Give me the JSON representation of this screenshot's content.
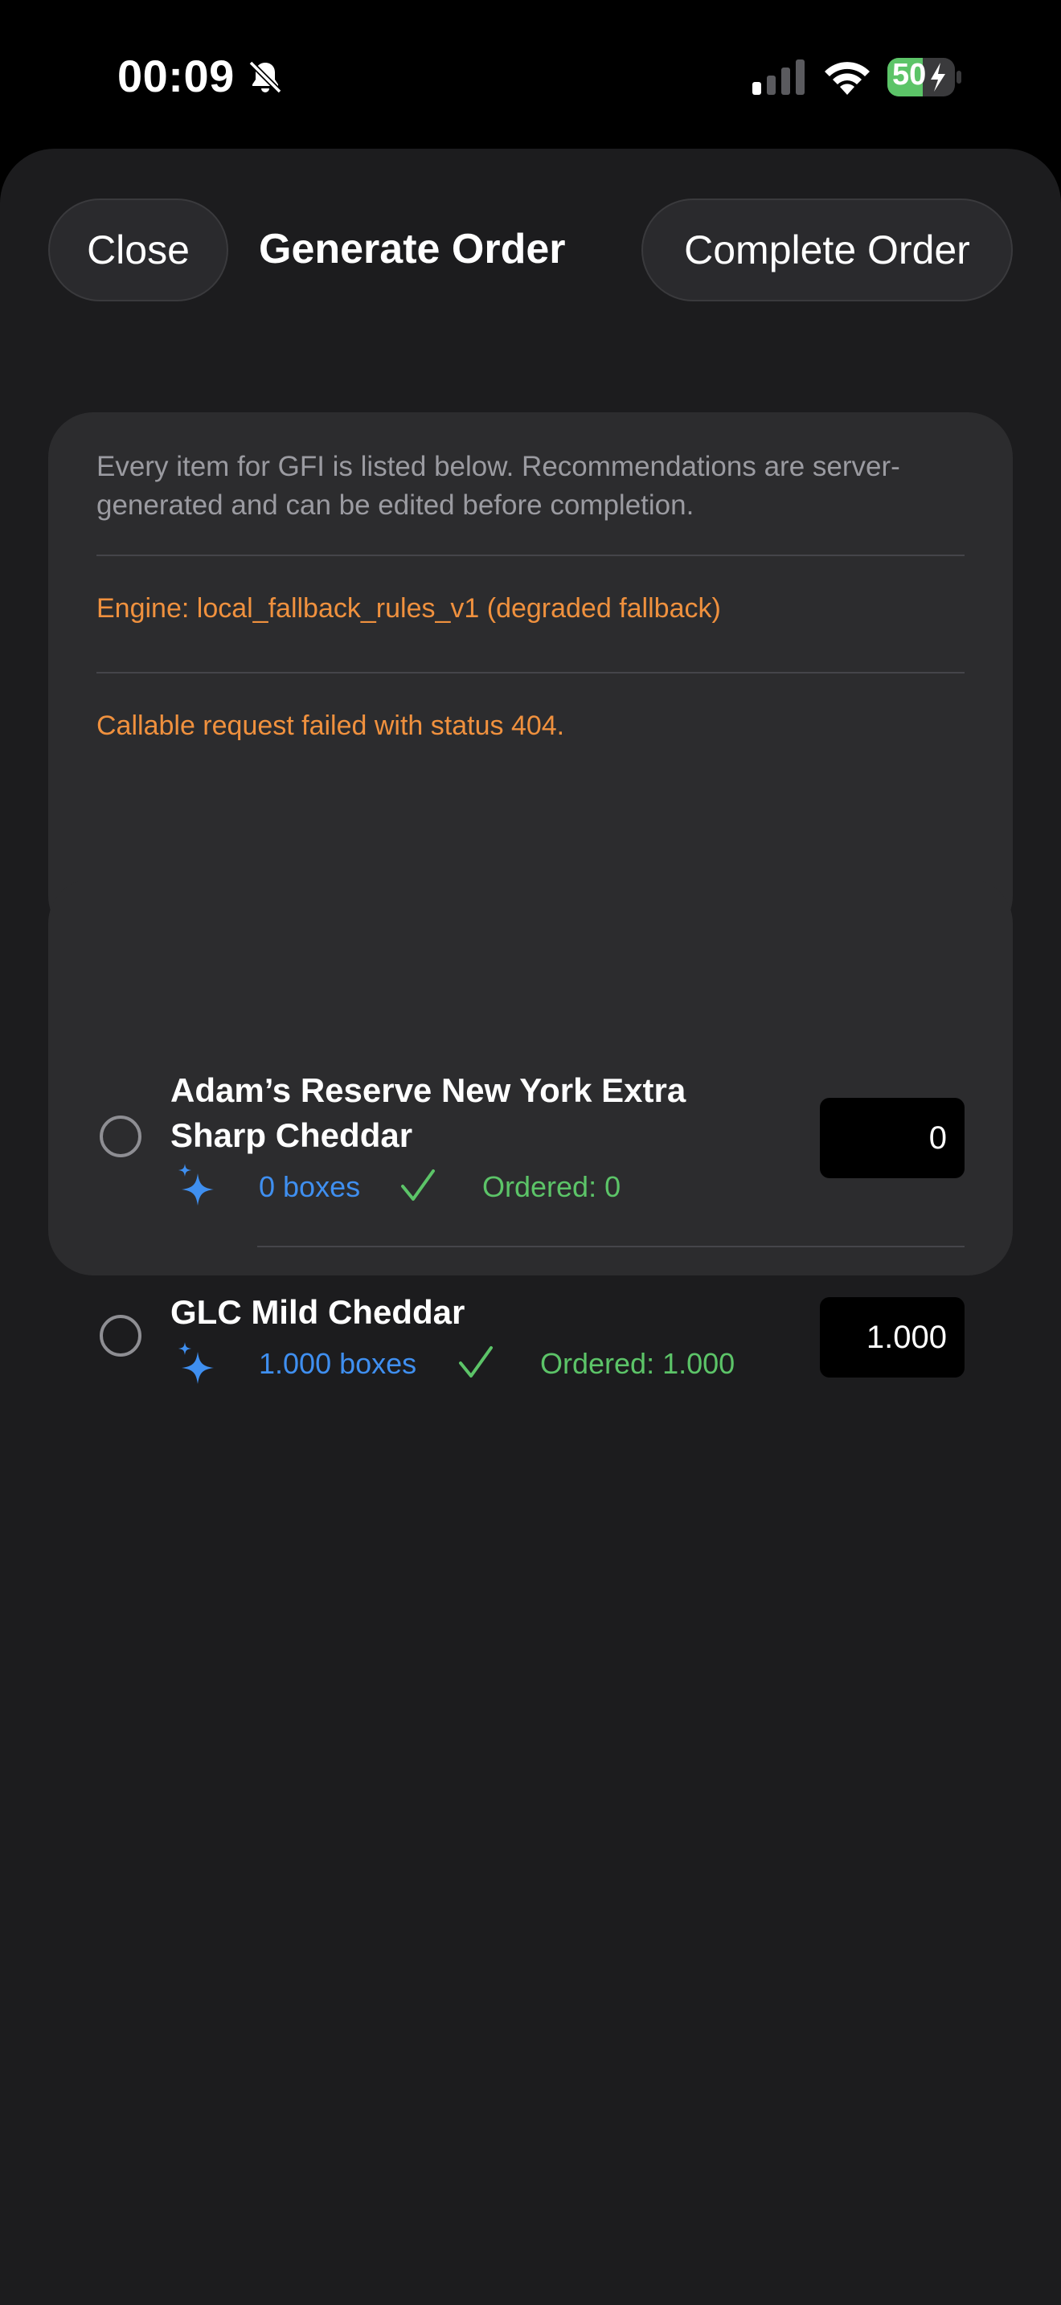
{
  "status_bar": {
    "time": "00:09",
    "battery": "50",
    "icons": [
      "bell-slash-icon",
      "cellular-signal-icon",
      "wifi-icon",
      "battery-charging-icon"
    ]
  },
  "header": {
    "close_label": "Close",
    "title": "Generate Order",
    "complete_label": "Complete Order"
  },
  "info": {
    "description": "Every item for GFI is listed below. Recommendations are server-generated and can be edited before completion.",
    "engine": "Engine: local_fallback_rules_v1 (degraded fallback)",
    "error": "Callable request failed with status 404."
  },
  "items": [
    {
      "name": "Adam’s Reserve New York Extra Sharp Cheddar",
      "recommended": "0 boxes",
      "ordered": "Ordered: 0",
      "quantity": "0"
    },
    {
      "name": "GLC Mild Cheddar",
      "recommended": "1.000 boxes",
      "ordered": "Ordered: 1.000",
      "quantity": "1.000"
    }
  ],
  "colors": {
    "accent_blue": "#3f8ff0",
    "ordered_green": "#5cc468",
    "warning_orange": "#f0913e",
    "battery_green": "#5cc468"
  }
}
